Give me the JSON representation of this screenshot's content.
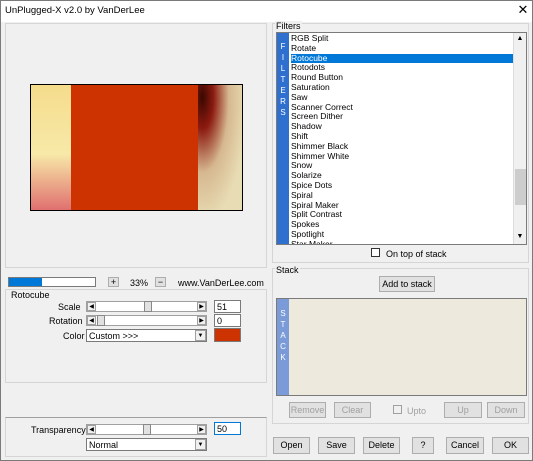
{
  "window": {
    "title": "UnPlugged-X v2.0 by VanDerLee",
    "close_glyph": "✕"
  },
  "zoom": {
    "plus": "+",
    "value": "33%",
    "minus": "−",
    "website": "www.VanDerLee.com",
    "progress": 0.38
  },
  "rotocube": {
    "group_label": "Rotocube",
    "scale_label": "Scale",
    "scale_value": "51",
    "rotation_label": "Rotation",
    "rotation_value": "0",
    "color_label": "Color",
    "color_option": "Custom >>>",
    "color_swatch": "#cc3300"
  },
  "transparency": {
    "label": "Transparency",
    "value": "50",
    "mode": "Normal"
  },
  "filters": {
    "group_label": "Filters",
    "side_label": [
      "F",
      "I",
      "L",
      "T",
      "E",
      "R",
      "S"
    ],
    "items": [
      "RGB Split",
      "Rotate",
      "Rotocube",
      "Rotodots",
      "Round Button",
      "Saturation",
      "Saw",
      "Scanner Correct",
      "Screen Dither",
      "Shadow",
      "Shift",
      "Shimmer Black",
      "Shimmer White",
      "Snow",
      "Solarize",
      "Spice Dots",
      "Spiral",
      "Spiral Maker",
      "Split Contrast",
      "Spokes",
      "Spotlight",
      "Star Maker"
    ],
    "selected_index": 2,
    "on_top_label": "On top of stack"
  },
  "stack": {
    "group_label": "Stack",
    "add_label": "Add to stack",
    "side_label": [
      "S",
      "T",
      "A",
      "C",
      "K"
    ],
    "remove_label": "Remove",
    "clear_label": "Clear",
    "upto_label": "Upto",
    "up_label": "Up",
    "down_label": "Down"
  },
  "buttons": {
    "open": "Open",
    "save": "Save",
    "delete": "Delete",
    "help": "?",
    "cancel": "Cancel",
    "ok": "OK"
  },
  "colors": {
    "accent": "#0078d7",
    "preview_red": "#cc3300",
    "side_bar": "#2f6fce",
    "stack_bar": "#7a9ad8"
  }
}
